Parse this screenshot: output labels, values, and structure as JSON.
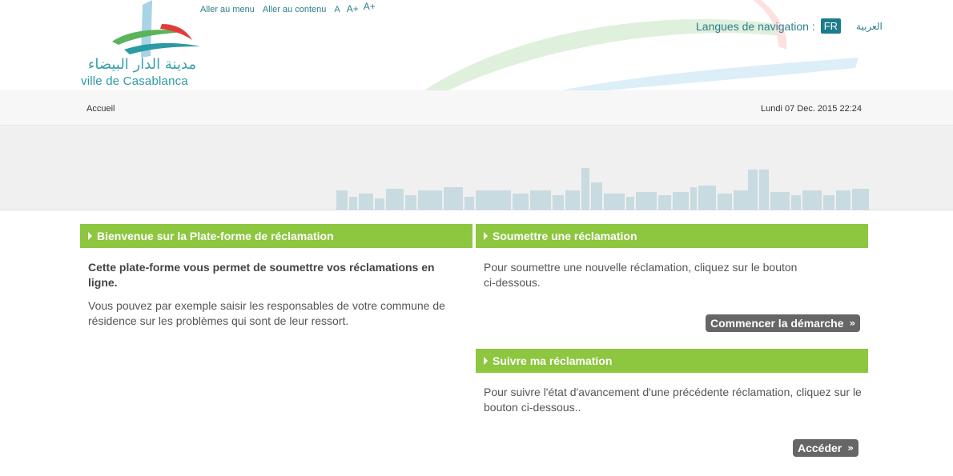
{
  "header": {
    "logo_ar": "مدينة الدار البيضاء",
    "logo_fr": "ville de Casablanca",
    "accessibility": {
      "menu_link": "Aller au menu",
      "content_link": "Aller au contenu",
      "font_normal": "A",
      "font_large": "A+",
      "font_larger": "A+"
    },
    "language": {
      "label": "Langues de navigation :",
      "fr": "FR",
      "ar": "العربية"
    }
  },
  "navbar": {
    "home": "Accueil",
    "datetime": "Lundi 07 Dec. 2015 22:24"
  },
  "welcome": {
    "title": "Bienvenue sur la Plate-forme de réclamation",
    "lead": "Cette plate-forme vous permet de soumettre vos réclamations en ligne.",
    "body": "Vous pouvez par exemple saisir les responsables de votre commune de résidence sur les problèmes qui sont de leur ressort."
  },
  "submit": {
    "title": "Soumettre une réclamation",
    "body": "Pour soumettre une nouvelle réclamation, cliquez sur le bouton ci-dessous.",
    "button": "Commencer la démarche"
  },
  "track": {
    "title": "Suivre ma réclamation",
    "body": "Pour suivre l'état d'avancement d'une précédente réclamation, cliquez sur le bouton ci-dessous..",
    "button": "Accéder"
  },
  "colors": {
    "accent_green": "#8dc63f",
    "link_teal": "#2a7e8e",
    "button_gray": "#666666"
  },
  "icons": [
    "arrow-right-icon",
    "double-chevron-right-icon"
  ]
}
